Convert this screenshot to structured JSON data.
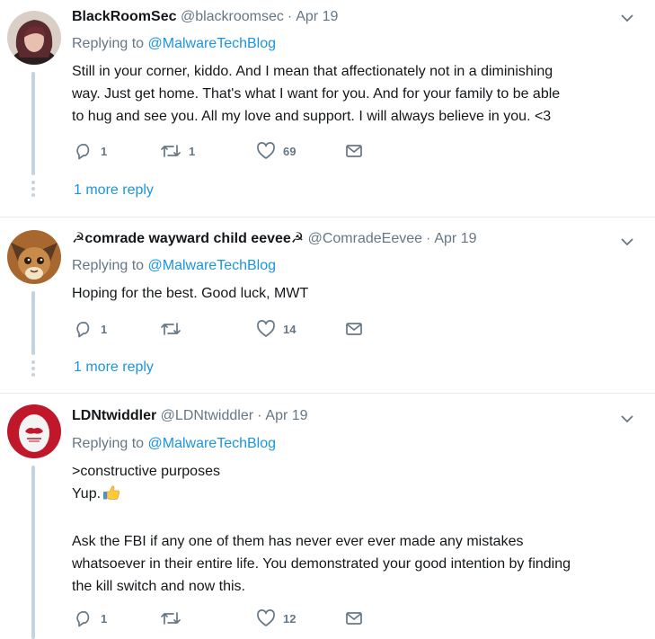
{
  "replying_prefix": "Replying to",
  "tweets": [
    {
      "name": "BlackRoomSec",
      "handle": "@blackroomsec",
      "date": "Apr 19",
      "mention": "@MalwareTechBlog",
      "lines": [
        "Still in your corner, kiddo. And I mean that affectionately not in a diminishing",
        "way.  Just get home.  That's what I want for you.  And for your family to be able",
        "to hug and see you.  All my love and support.  I will always believe in you.  <3"
      ],
      "replies": "1",
      "retweets": "1",
      "likes": "69",
      "more_replies": "1 more reply"
    },
    {
      "name": "☭comrade wayward child eevee☭",
      "handle": "@ComradeEevee",
      "date": "Apr 19",
      "mention": "@MalwareTechBlog",
      "lines": [
        "Hoping for the best. Good luck, MWT"
      ],
      "replies": "1",
      "retweets": "",
      "likes": "14",
      "more_replies": "1 more reply"
    },
    {
      "name": "LDNtwiddler",
      "handle": "@LDNtwiddler",
      "date": "Apr 19",
      "mention": "@MalwareTechBlog",
      "lines": [
        ">constructive purposes",
        "Yup.",
        "",
        "Ask the FBI if any one of them has never ever ever made any mistakes",
        "whatsoever in their entire life. You demonstrated your good intention by finding",
        "the kill switch and now this."
      ],
      "replies": "1",
      "retweets": "",
      "likes": "12"
    }
  ],
  "colors": {
    "link": "#1b95e0",
    "secondary_text": "#657786",
    "thread_line": "#c4d3e0",
    "divider": "#e6ecf0",
    "egg_avatar_ring": "#c0182a"
  },
  "icons": [
    "reply-icon",
    "retweet-icon",
    "like-icon",
    "direct-message-icon",
    "chevron-down-icon",
    "thumbs-up-emoji"
  ]
}
